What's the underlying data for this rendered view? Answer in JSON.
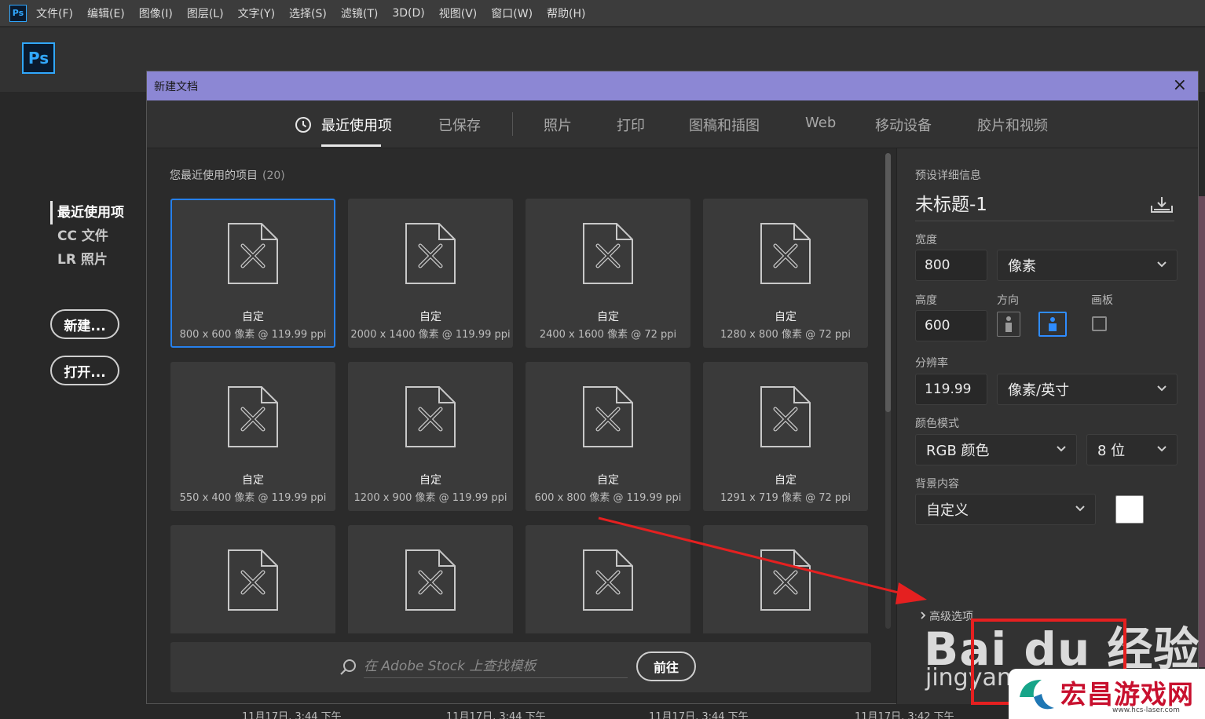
{
  "app": {
    "small_logo": "Ps",
    "logo": "Ps",
    "menu": [
      "文件(F)",
      "编辑(E)",
      "图像(I)",
      "图层(L)",
      "文字(Y)",
      "选择(S)",
      "滤镜(T)",
      "3D(D)",
      "视图(V)",
      "窗口(W)",
      "帮助(H)"
    ]
  },
  "home": {
    "nav": [
      "最近使用项",
      "CC 文件",
      "LR 照片"
    ],
    "new_button": "新建...",
    "open_button": "打开...",
    "timestamps": [
      "11月17日, 3:44 下午",
      "11月17日, 3:44 下午",
      "11月17日, 3:44 下午",
      "11月17日, 3:42 下午"
    ]
  },
  "dialog": {
    "title": "新建文档",
    "close": "×",
    "tabs": [
      "最近使用项",
      "已保存",
      "照片",
      "打印",
      "图稿和插图",
      "Web",
      "移动设备",
      "胶片和视频"
    ],
    "active_tab": 0,
    "recent_label": "您最近使用的项目",
    "recent_count": "(20)",
    "cards": [
      {
        "name": "自定",
        "desc": "800 x 600 像素 @ 119.99 ppi"
      },
      {
        "name": "自定",
        "desc": "2000 x 1400 像素 @ 119.99 ppi"
      },
      {
        "name": "自定",
        "desc": "2400 x 1600 像素 @ 72 ppi"
      },
      {
        "name": "自定",
        "desc": "1280 x 800 像素 @ 72 ppi"
      },
      {
        "name": "自定",
        "desc": "550 x 400 像素 @ 119.99 ppi"
      },
      {
        "name": "自定",
        "desc": "1200 x 900 像素 @ 119.99 ppi"
      },
      {
        "name": "自定",
        "desc": "600 x 800 像素 @ 119.99 ppi"
      },
      {
        "name": "自定",
        "desc": "1291 x 719 像素 @ 72 ppi"
      },
      {
        "name": "",
        "desc": ""
      },
      {
        "name": "",
        "desc": ""
      },
      {
        "name": "",
        "desc": ""
      },
      {
        "name": "",
        "desc": ""
      }
    ],
    "stock": {
      "placeholder": "在 Adobe Stock 上查找模板",
      "go": "前往"
    },
    "preset": {
      "section": "预设详细信息",
      "doc_name": "未标题-1",
      "width_label": "宽度",
      "width": "800",
      "width_unit": "像素",
      "height_label": "高度",
      "height": "600",
      "orientation_label": "方向",
      "artboard_label": "画板",
      "resolution_label": "分辨率",
      "resolution": "119.99",
      "resolution_unit": "像素/英寸",
      "color_mode_label": "颜色模式",
      "color_mode": "RGB 颜色",
      "bit_depth": "8 位",
      "background_label": "背景内容",
      "background": "自定义",
      "background_color": "#ffffff",
      "advanced": "高级选项"
    }
  },
  "overlay": {
    "watermark_baidu": "Bai du 经验",
    "watermark_jingyan": "jingyan",
    "corner_logo": "宏昌游戏网",
    "corner_url": "www.hcs-laser.com"
  },
  "colors": {
    "accent": "#2680eb",
    "title_bar": "#8c87d4",
    "arrow": "#e52020"
  }
}
